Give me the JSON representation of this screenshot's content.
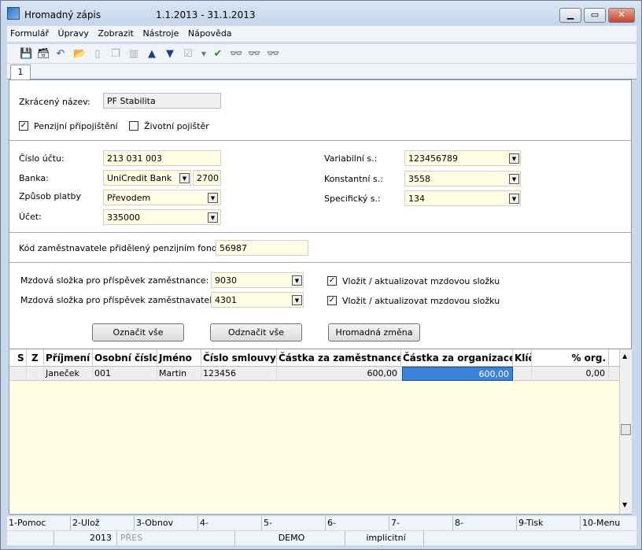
{
  "window": {
    "title": "Hromadný zápis",
    "period": "1.1.2013 - 31.1.2013",
    "min": "▁",
    "max": "▭",
    "close": "✕"
  },
  "menu": [
    "Formulář",
    "Úpravy",
    "Zobrazit",
    "Nástroje",
    "Nápověda"
  ],
  "toolbar_icons": [
    "save-icon",
    "save-as-icon",
    "undo-icon",
    "open-icon",
    "new-icon",
    "copy-icon",
    "book-icon",
    "arrow-up-icon",
    "arrow-down-icon",
    "check-list-icon",
    "dropdown-icon",
    "filter-icon",
    "binoculars-icon",
    "binoculars-next-icon",
    "binoculars-prev-icon"
  ],
  "tab": "1",
  "form": {
    "short_name_label": "Zkrácený název:",
    "short_name": "PF Stabilita",
    "pension_label": "Penzijní připojištění",
    "pension_checked": true,
    "life_label": "Životní pojištěr",
    "life_checked": false,
    "account_no_label": "Číslo účtu:",
    "account_no": "213 031 003",
    "bank_label": "Banka:",
    "bank": "UniCredit Bank",
    "bank_code": "2700",
    "payment_label": "Způsob platby",
    "payment": "Převodem",
    "ucet_label": "Účet:",
    "ucet": "335000",
    "var_label": "Variabilní s.:",
    "var": "123456789",
    "const_label": "Konstantní s.:",
    "const": "3558",
    "spec_label": "Specifický s.:",
    "spec": "134",
    "employer_code_label": "Kód zaměstnavatele přidělený penzijním fondem:",
    "employer_code": "56987",
    "wage_emp_label": "Mzdová složka pro příspěvek zaměstnance:",
    "wage_emp": "9030",
    "wage_er_label": "Mzdová složka pro příspěvek zaměstnavatele:",
    "wage_er": "4301",
    "insert_label_1": "Vložit / aktualizovat mzdovou složku",
    "insert_label_2": "Vložit / aktualizovat mzdovou složku"
  },
  "buttons": {
    "mark_all": "Označit vše",
    "unmark_all": "Odznačit vše",
    "bulk_change": "Hromadná změna"
  },
  "grid": {
    "headers": [
      "S",
      "Z",
      "Příjmení",
      "Osobní číslo",
      "Jméno",
      "Číslo smlouvy",
      "Částka za zaměstnance",
      "Částka za organizace",
      "Klíč",
      "% org."
    ],
    "rows": [
      [
        "",
        "",
        "Janeček",
        "001",
        "Martin",
        "123456",
        "600,00",
        "600,00",
        "",
        "0,00"
      ]
    ]
  },
  "fkeys": [
    "1-Pomoc",
    "2-Ulož",
    "3-Obnov",
    "4-",
    "5-",
    "6-",
    "7-",
    "8-",
    "9-Tisk",
    "10-Menu"
  ],
  "status": [
    "2013",
    "PŘES",
    "DEMO",
    "implicitní"
  ]
}
